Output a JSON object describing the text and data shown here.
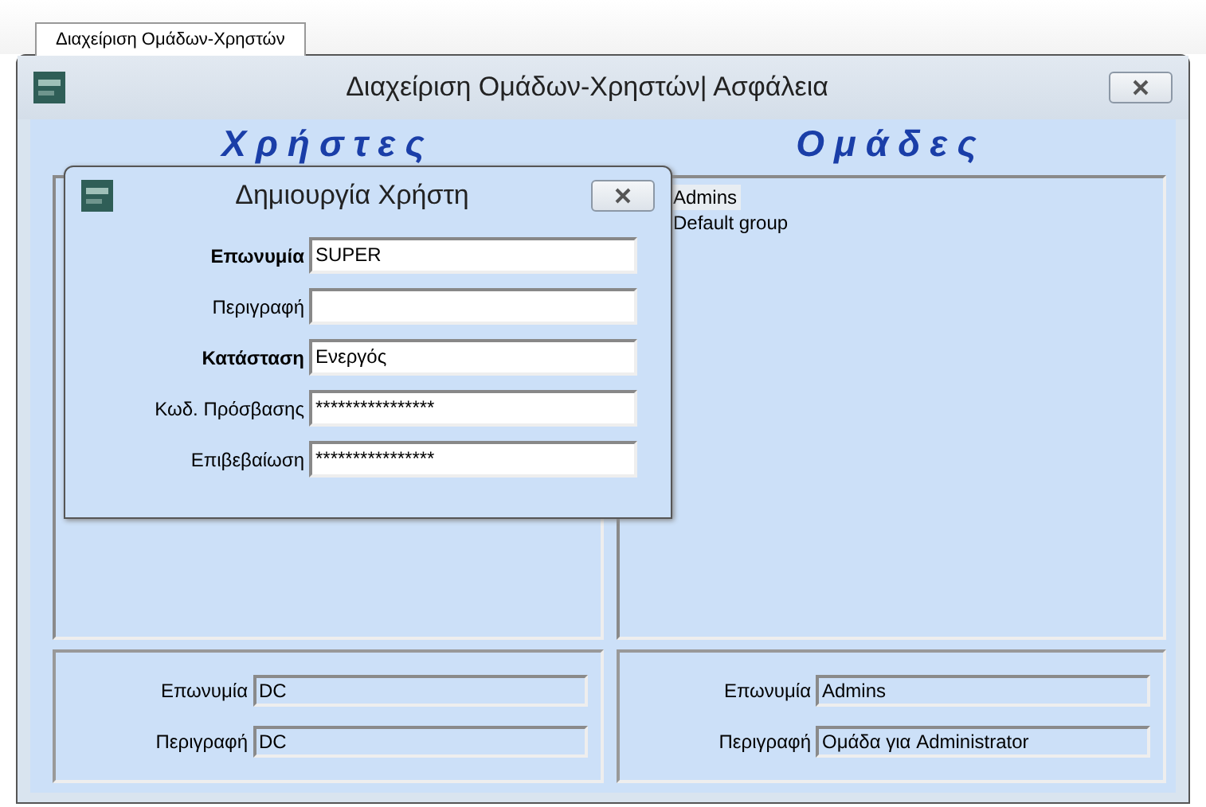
{
  "tabs": [
    {
      "label": "Διαχείριση Ομάδων-Χρηστών",
      "selected": true
    }
  ],
  "window": {
    "title": "Διαχείριση Ομάδων-Χρηστών| Ασφάλεια"
  },
  "users": {
    "heading": "Χρήστες",
    "details": [
      {
        "label": "Επωνυμία",
        "value": "DC"
      },
      {
        "label": "Περιγραφή",
        "value": "DC"
      }
    ]
  },
  "groups": {
    "heading": "Ομάδες",
    "items": [
      {
        "label": "Admins",
        "selected": true
      },
      {
        "label": "Default group",
        "selected": false
      }
    ],
    "details": [
      {
        "label": "Επωνυμία",
        "value": "Admins"
      },
      {
        "label": "Περιγραφή",
        "value": "Ομάδα για Administrator"
      }
    ]
  },
  "dialog": {
    "title": "Δημιουργία Χρήστη",
    "fields": [
      {
        "label": "Επωνυμία",
        "value": "SUPER",
        "bold": true
      },
      {
        "label": "Περιγραφή",
        "bold": false
      },
      {
        "label": "Κατάσταση",
        "value": "Ενεργός",
        "bold": true
      },
      {
        "label": "Κωδ. Πρόσβασης",
        "value": "****************",
        "bold": false
      },
      {
        "label": "Επιβεβαίωση",
        "value": "****************",
        "bold": false
      }
    ]
  }
}
